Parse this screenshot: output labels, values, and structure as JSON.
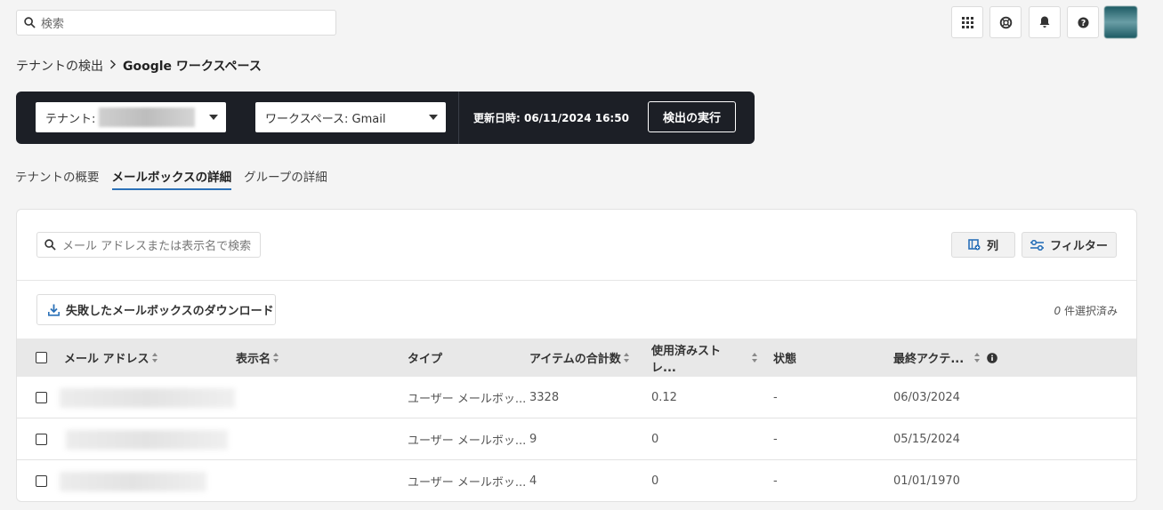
{
  "search": {
    "placeholder": "検索"
  },
  "breadcrumb": {
    "parent": "テナントの検出",
    "current": "Google ワークスペース"
  },
  "tenant_bar": {
    "tenant_label": "テナント:",
    "workspace_label": "ワークスペース: Gmail",
    "updated": "更新日時: 06/11/2024 16:50",
    "run_button": "検出の実行"
  },
  "tabs": [
    "テナントの概要",
    "メールボックスの詳細",
    "グループの詳細"
  ],
  "card": {
    "search_placeholder": "メール アドレスまたは表示名で検索",
    "columns_button": "列",
    "filter_button": "フィルター",
    "download_button": "失敗したメールボックスのダウンロード",
    "selected_count": "0",
    "selected_suffix": " 件選択済み"
  },
  "table": {
    "headers": {
      "email": "メール アドレス",
      "display_name": "表示名",
      "type": "タイプ",
      "item_total": "アイテムの合計数",
      "storage": "使用済みストレ...",
      "status": "状態",
      "last_activity": "最終アクテ..."
    },
    "rows": [
      {
        "type": "ユーザー メールボッ...",
        "items": "3328",
        "storage": "0.12",
        "status": "-",
        "last": "06/03/2024"
      },
      {
        "type": "ユーザー メールボッ...",
        "items": "9",
        "storage": "0",
        "status": "-",
        "last": "05/15/2024"
      },
      {
        "type": "ユーザー メールボッ...",
        "items": "4",
        "storage": "0",
        "status": "-",
        "last": "01/01/1970"
      }
    ]
  },
  "colors": {
    "accent": "#2b71b8",
    "dark_bar": "#1c1f26"
  },
  "icons": [
    "search-icon",
    "apps-grid-icon",
    "support-icon",
    "bell-icon",
    "help-icon",
    "chevron-right-icon",
    "columns-icon",
    "filter-icon",
    "download-icon",
    "info-icon"
  ]
}
